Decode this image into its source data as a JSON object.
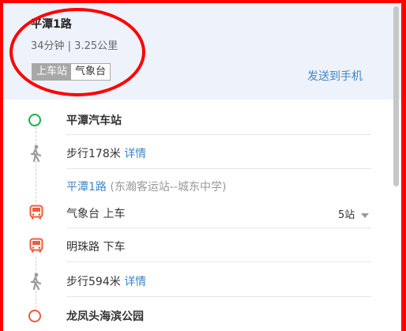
{
  "route": {
    "title": "平潭1路",
    "meta": "34分钟 | 3.25公里",
    "toggle": [
      "上车站",
      "气象台"
    ],
    "send_to_phone": "发送到手机"
  },
  "steps": [
    {
      "type": "start",
      "name": "平潭汽车站",
      "icon": "start-circle-icon"
    },
    {
      "type": "walk",
      "text": "步行178米",
      "detail": "详情",
      "icon": "walk-icon"
    },
    {
      "type": "line",
      "name": "平潭1路",
      "direction": "(东瀚客运站--城东中学)"
    },
    {
      "type": "board",
      "text": "气象台 上车",
      "stops": "5站",
      "icon": "bus-icon"
    },
    {
      "type": "alight",
      "text": "明珠路 下车",
      "icon": "bus-icon"
    },
    {
      "type": "walk",
      "text": "步行594米",
      "detail": "详情",
      "icon": "walk-icon"
    },
    {
      "type": "end",
      "name": "龙凤头海滨公园",
      "icon": "end-circle-icon"
    }
  ],
  "colors": {
    "accent": "#3b87c8",
    "header_bg": "#eef2fb",
    "start": "#1aaf50",
    "bus": "#ef5b3c",
    "annotation": "#ff0000"
  }
}
